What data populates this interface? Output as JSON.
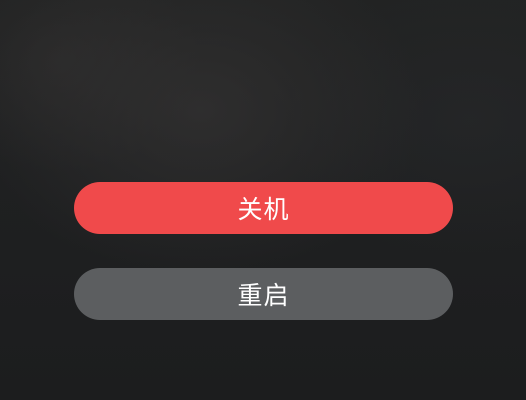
{
  "power_menu": {
    "shutdown_label": "关机",
    "restart_label": "重启"
  },
  "colors": {
    "shutdown_button": "#f04a4b",
    "restart_button": "#5c5e60",
    "background": "#1f2021",
    "label_text": "#ffffff"
  }
}
